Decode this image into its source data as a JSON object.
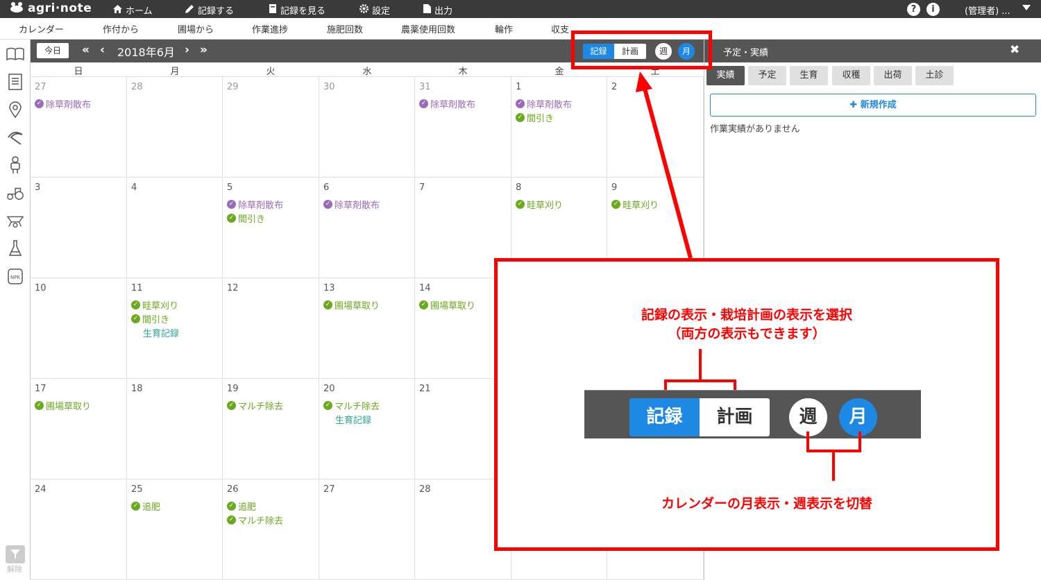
{
  "app": {
    "logo": "agri·note"
  },
  "topnav": {
    "items": [
      {
        "icon": "home-icon",
        "label": "ホーム"
      },
      {
        "icon": "pencil-icon",
        "label": "記録する"
      },
      {
        "icon": "book-icon",
        "label": "記録を見る"
      },
      {
        "icon": "gear-icon",
        "label": "設定"
      },
      {
        "icon": "file-icon",
        "label": "出力"
      }
    ],
    "help": "?",
    "info": "i",
    "user": "(管理者) ..."
  },
  "subnav": [
    "カレンダー",
    "作付から",
    "圃場から",
    "作業進捗",
    "施肥回数",
    "農薬使用回数",
    "輪作",
    "収支"
  ],
  "sidebar": {
    "filter_label": "解除",
    "npk_label": "NPK"
  },
  "calendar": {
    "today_label": "今日",
    "month_label": "2018年6月",
    "view_record": "記録",
    "view_plan": "計画",
    "view_week": "週",
    "view_month": "月",
    "weekdays": [
      "日",
      "月",
      "火",
      "水",
      "木",
      "金",
      "土"
    ],
    "weeks": [
      [
        {
          "day": "27",
          "other": true,
          "events": [
            {
              "c": "purple",
              "t": "除草剤散布"
            }
          ]
        },
        {
          "day": "28",
          "other": true,
          "events": []
        },
        {
          "day": "29",
          "other": true,
          "events": []
        },
        {
          "day": "30",
          "other": true,
          "events": []
        },
        {
          "day": "31",
          "other": true,
          "events": [
            {
              "c": "purple",
              "t": "除草剤散布"
            }
          ]
        },
        {
          "day": "1",
          "events": [
            {
              "c": "purple",
              "t": "除草剤散布"
            },
            {
              "c": "green",
              "t": "間引き"
            }
          ]
        },
        {
          "day": "2",
          "events": []
        }
      ],
      [
        {
          "day": "3",
          "events": []
        },
        {
          "day": "4",
          "events": []
        },
        {
          "day": "5",
          "events": [
            {
              "c": "purple",
              "t": "除草剤散布"
            },
            {
              "c": "green",
              "t": "間引き"
            }
          ]
        },
        {
          "day": "6",
          "events": [
            {
              "c": "purple",
              "t": "除草剤散布"
            }
          ]
        },
        {
          "day": "7",
          "events": []
        },
        {
          "day": "8",
          "events": [
            {
              "c": "green",
              "t": "畦草刈り"
            }
          ]
        },
        {
          "day": "9",
          "events": [
            {
              "c": "green",
              "t": "畦草刈り"
            }
          ]
        }
      ],
      [
        {
          "day": "10",
          "events": []
        },
        {
          "day": "11",
          "events": [
            {
              "c": "green",
              "t": "畦草刈り"
            },
            {
              "c": "green",
              "t": "間引き"
            },
            {
              "c": "teal",
              "t": "生育記録"
            }
          ]
        },
        {
          "day": "12",
          "events": []
        },
        {
          "day": "13",
          "events": [
            {
              "c": "green",
              "t": "圃場草取り"
            }
          ]
        },
        {
          "day": "14",
          "events": [
            {
              "c": "green",
              "t": "圃場草取り"
            }
          ]
        },
        {
          "day": "",
          "events": []
        },
        {
          "day": "",
          "events": []
        }
      ],
      [
        {
          "day": "17",
          "events": [
            {
              "c": "green",
              "t": "圃場草取り"
            }
          ]
        },
        {
          "day": "18",
          "events": []
        },
        {
          "day": "19",
          "events": [
            {
              "c": "green",
              "t": "マルチ除去"
            }
          ]
        },
        {
          "day": "20",
          "events": [
            {
              "c": "green",
              "t": "マルチ除去"
            },
            {
              "c": "teal",
              "t": "生育記録"
            }
          ]
        },
        {
          "day": "21",
          "events": []
        },
        {
          "day": "",
          "events": []
        },
        {
          "day": "",
          "events": []
        }
      ],
      [
        {
          "day": "24",
          "events": []
        },
        {
          "day": "25",
          "events": [
            {
              "c": "green",
              "t": "追肥"
            }
          ]
        },
        {
          "day": "26",
          "events": [
            {
              "c": "green",
              "t": "追肥"
            },
            {
              "c": "green",
              "t": "マルチ除去"
            }
          ]
        },
        {
          "day": "27",
          "events": []
        },
        {
          "day": "28",
          "events": []
        },
        {
          "day": "",
          "events": []
        },
        {
          "day": "",
          "events": []
        }
      ]
    ]
  },
  "right_panel": {
    "title": "予定・実績",
    "close": "✖",
    "tabs": [
      "実績",
      "予定",
      "生育",
      "収穫",
      "出荷",
      "土診"
    ],
    "new_button": "新規作成",
    "empty_message": "作業実績がありません"
  },
  "annotation": {
    "callout_line1": "記録の表示・栽培計画の表示を選択",
    "callout_line2": "（両方の表示もできます）",
    "callout_bottom": "カレンダーの月表示・週表示を切替",
    "zoom_record": "記録",
    "zoom_plan": "計画",
    "zoom_week": "週",
    "zoom_month": "月"
  },
  "colors": {
    "accent": "#1e88e5",
    "annotation_red": "#ff0000",
    "event_purple": "#9b6ab8",
    "event_green": "#6aaa1e",
    "event_teal": "#2aa392"
  }
}
